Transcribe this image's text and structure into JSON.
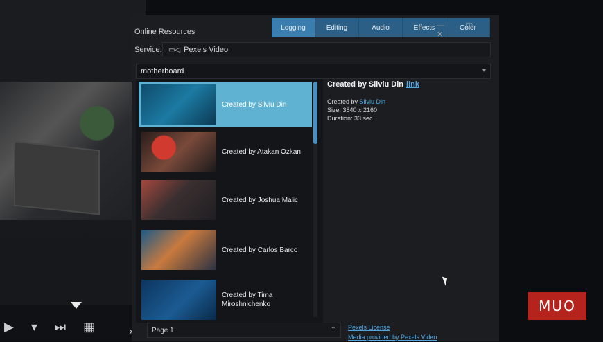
{
  "panel": {
    "title": "Online Resources",
    "tabs": [
      {
        "label": "Logging",
        "active": true
      },
      {
        "label": "Editing",
        "active": false
      },
      {
        "label": "Audio",
        "active": false
      },
      {
        "label": "Effects",
        "active": false
      },
      {
        "label": "Color",
        "active": false
      }
    ],
    "window_controls": "— ▢ ✕"
  },
  "service": {
    "label": "Service:",
    "value": "Pexels Video",
    "icon": "video-camera-icon"
  },
  "search": {
    "value": "motherboard",
    "dropdown_icon": "chevron-down-icon"
  },
  "results": [
    {
      "label": "Created by Silviu Din",
      "selected": true
    },
    {
      "label": "Created by Atakan Ozkan",
      "selected": false
    },
    {
      "label": "Created by Joshua Malic",
      "selected": false
    },
    {
      "label": "Created by Carlos  Barco",
      "selected": false
    },
    {
      "label": "Created by Tima Miroshnichenko",
      "selected": false
    }
  ],
  "pager": {
    "value": "Page 1"
  },
  "details": {
    "title": "Created by Silviu Din",
    "title_link": "link",
    "created_by_prefix": "Created by",
    "created_by_name": "Silviu Din",
    "size": "Size: 3840 x 2160",
    "duration": "Duration: 33 sec"
  },
  "footer": {
    "license": "Pexels License",
    "provided_by": "Media provided by Pexels Video"
  },
  "logo": "MUO",
  "colors": {
    "accent": "#3a7eb0",
    "selected": "#5fb2d2",
    "link": "#4ea7e0",
    "logo": "#b6231c"
  }
}
